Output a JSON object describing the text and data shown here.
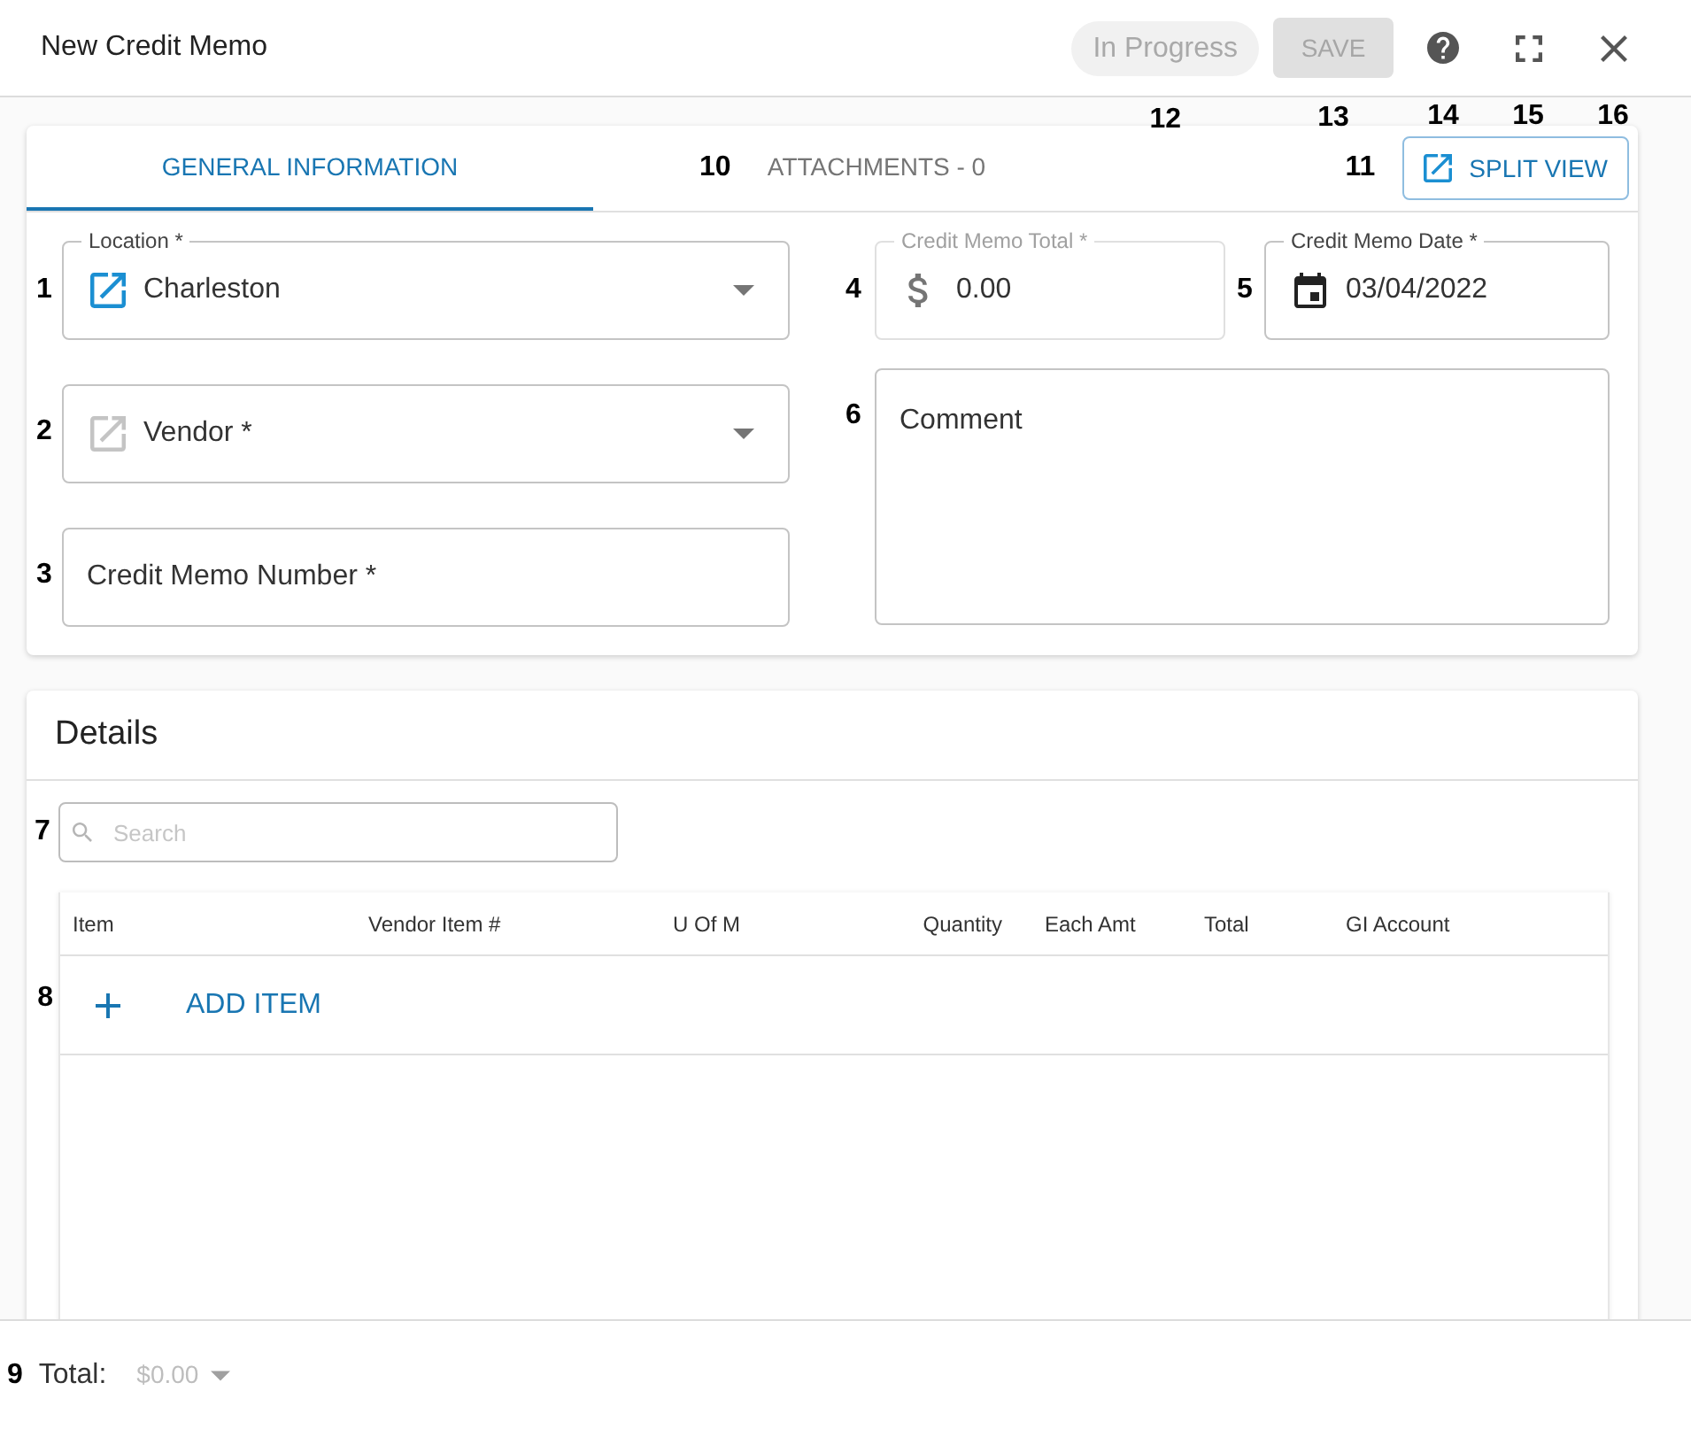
{
  "header": {
    "title": "New Credit Memo",
    "status": {
      "label": "In Progress",
      "marker": "12"
    },
    "save_button": {
      "label": "SAVE",
      "disabled": true,
      "marker": "13"
    },
    "icon_buttons": [
      {
        "kind": "help",
        "marker": "14"
      },
      {
        "kind": "fullscreen",
        "marker": "15"
      },
      {
        "kind": "close",
        "marker": "16"
      }
    ]
  },
  "tabs": [
    {
      "label": "GENERAL INFORMATION",
      "selected": true
    },
    {
      "label": "ATTACHMENTS - 0",
      "selected": false,
      "marker": "10"
    }
  ],
  "split_view_button": {
    "label": "SPLIT VIEW",
    "marker": "11"
  },
  "left_fields": [
    {
      "kind": "select",
      "label": "Location *",
      "value": "Charleston",
      "link_enabled": true,
      "disabled": false,
      "marker": "1"
    },
    {
      "kind": "select",
      "placeholder": "Vendor *",
      "link_enabled": false,
      "disabled": false,
      "marker": "2"
    },
    {
      "kind": "text",
      "placeholder": "Credit Memo Number *",
      "disabled": false,
      "marker": "3"
    }
  ],
  "right_fields": [
    {
      "kind": "currency",
      "label": "Credit Memo Total *",
      "value": "0.00",
      "disabled": true,
      "marker": "4"
    },
    {
      "kind": "date",
      "label": "Credit Memo Date *",
      "value": "03/04/2022",
      "disabled": false,
      "marker": "5"
    },
    {
      "kind": "textarea",
      "placeholder": "Comment",
      "disabled": false,
      "marker": "6"
    }
  ],
  "details": {
    "title": "Details",
    "search": {
      "placeholder": "Search",
      "marker": "7"
    },
    "table": {
      "columns": [
        "Item",
        "Vendor Item #",
        "U Of M",
        "Quantity",
        "Each Amt",
        "Total",
        "GI Account"
      ],
      "add_item": {
        "label": "ADD ITEM",
        "marker": "8"
      }
    }
  },
  "footer": {
    "label": "Total:",
    "value": "$0.00",
    "marker": "9"
  }
}
